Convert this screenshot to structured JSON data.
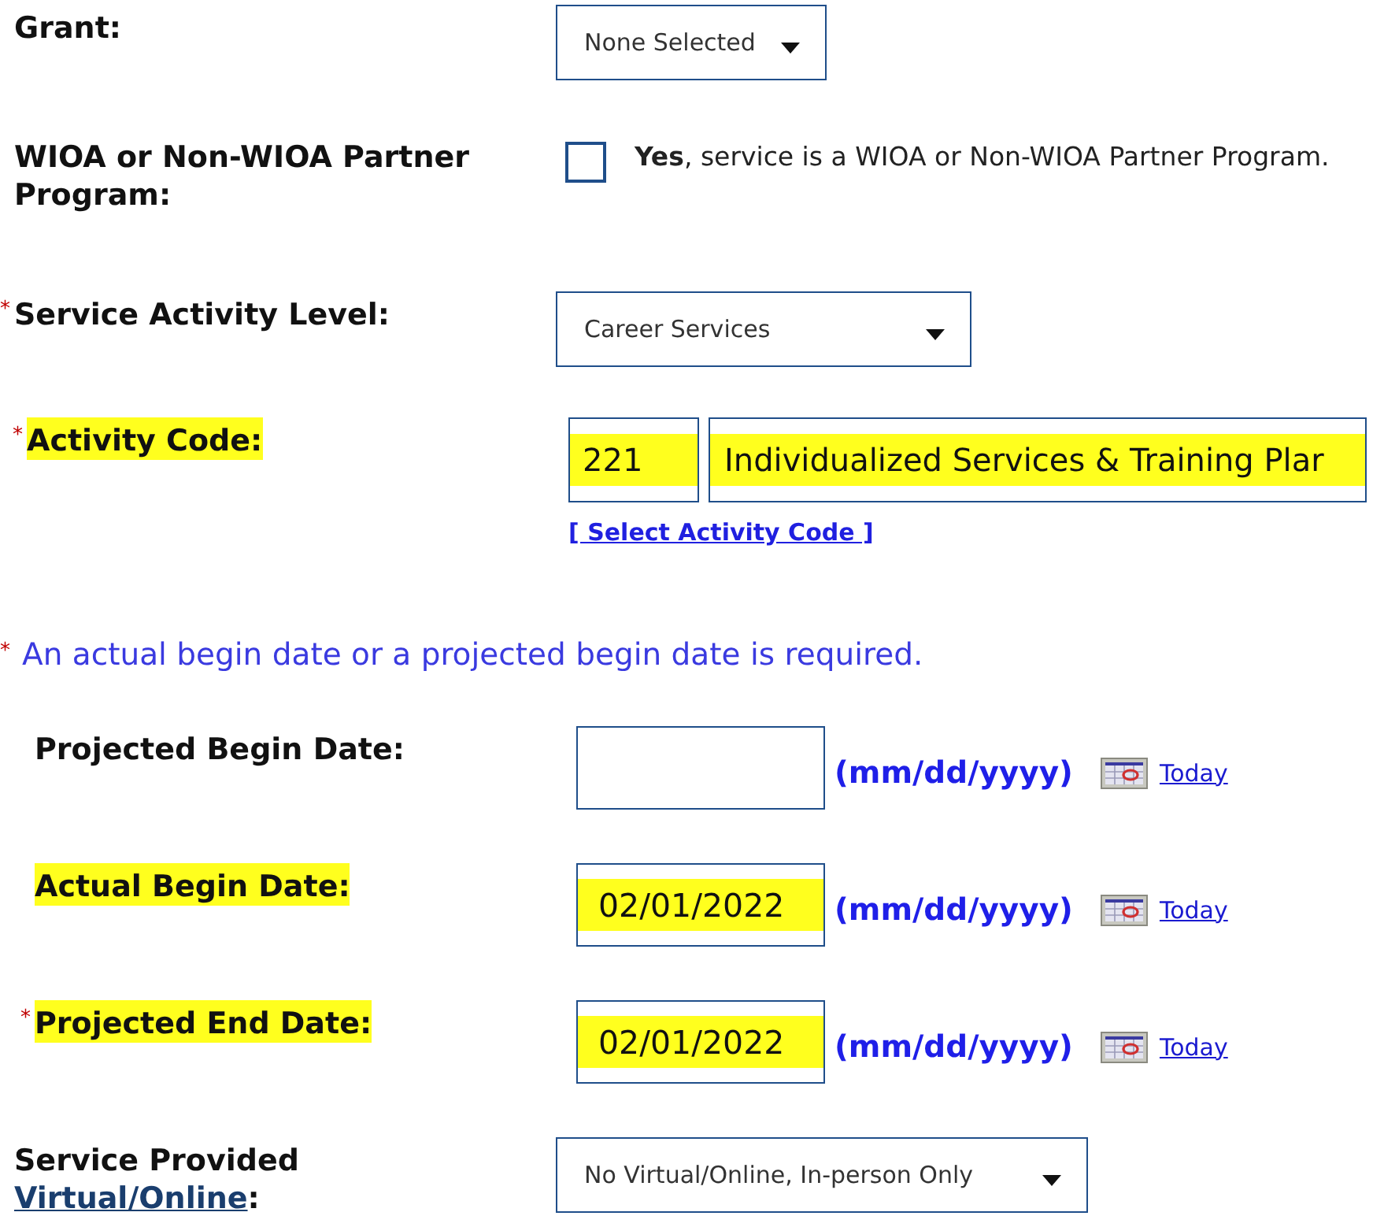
{
  "rows": [
    {
      "kind": "dropdown",
      "label": "Grant:",
      "value": "None Selected"
    },
    {
      "kind": "checkbox",
      "label": "WIOA or Non-WIOA Partner Program:",
      "checked": false,
      "option_bold": "Yes",
      "option_text": ", service is a WIOA or Non-WIOA Partner Program."
    },
    {
      "kind": "dropdown",
      "label": "Service Activity Level:",
      "marker": "*",
      "value": "Career Services"
    },
    {
      "kind": "code",
      "label": "Activity Code:",
      "marker": "*",
      "label_highlighted": true,
      "code": "221",
      "name": "Individualized Services & Training Plar",
      "field_highlighted": true,
      "link": "[ Select Activity Code ]"
    },
    {
      "kind": "note",
      "marker": "*",
      "text": "An actual begin date or a projected begin date is required."
    },
    {
      "kind": "date",
      "label": "Projected Begin Date:",
      "label_highlighted": false,
      "value": "",
      "field_highlighted": false,
      "format": "(mm/dd/yyyy)",
      "link": "Today"
    },
    {
      "kind": "date",
      "label": "Actual Begin Date:",
      "label_highlighted": true,
      "value": "02/01/2022",
      "field_highlighted": true,
      "format": "(mm/dd/yyyy)",
      "link": "Today"
    },
    {
      "kind": "date",
      "label": "Projected End Date:",
      "marker": "*",
      "label_highlighted": true,
      "value": "02/01/2022",
      "field_highlighted": true,
      "format": "(mm/dd/yyyy)",
      "link": "Today"
    },
    {
      "kind": "dropdown",
      "label": "Service Provided",
      "label_link": "Virtual/Online",
      "label_suffix": ":",
      "value": "No Virtual/Online, In-person Only"
    }
  ]
}
